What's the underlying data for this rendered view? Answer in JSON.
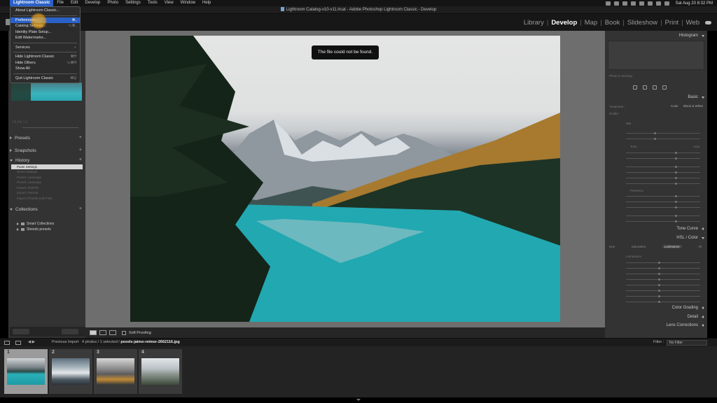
{
  "menubar": {
    "apple_icon": "apple-icon",
    "items": [
      "Lightroom Classic",
      "File",
      "Edit",
      "Develop",
      "Photo",
      "Settings",
      "Tools",
      "View",
      "Window",
      "Help"
    ],
    "clock": "Sat Aug 20  8:32 PM"
  },
  "window": {
    "title": "Lightroom Catalog-v10-v11.lrcat - Adobe Photoshop Lightroom Classic - Develop"
  },
  "modules": [
    "Library",
    "Develop",
    "Map",
    "Book",
    "Slideshow",
    "Print",
    "Web"
  ],
  "active_module": "Develop",
  "app_menu": {
    "items": [
      {
        "label": "About Lightroom Classic...",
        "shortcut": ""
      },
      {
        "label": "Preferences...",
        "shortcut": "⌘,"
      },
      {
        "label": "Catalog Settings...",
        "shortcut": "⌥⌘,"
      },
      {
        "label": "Identity Plate Setup...",
        "shortcut": ""
      },
      {
        "label": "Edit Watermarks...",
        "shortcut": ""
      },
      {
        "label": "Services",
        "shortcut": ""
      },
      {
        "label": "Hide Lightroom Classic",
        "shortcut": "⌘H"
      },
      {
        "label": "Hide Others",
        "shortcut": "⌥⌘H"
      },
      {
        "label": "Show All",
        "shortcut": ""
      },
      {
        "label": "Quit Lightroom Classic",
        "shortcut": "⌘Q"
      }
    ]
  },
  "left_panel": {
    "navigator_faint": "Fit  Fill  1:1",
    "sections": [
      "Presets",
      "Snapshots",
      "History",
      "Collections"
    ],
    "history_items": [
      {
        "label": "Paste Settings",
        "value": ""
      },
      {
        "label": "Reset Settings",
        "value": ""
      },
      {
        "label": "Preset: Lanscape",
        "value": ""
      },
      {
        "label": "Preset: Lanscape",
        "value": ""
      },
      {
        "label": "Preset: PORTR",
        "value": ""
      },
      {
        "label": "Export: Portrait",
        "value": ""
      },
      {
        "label": "Import (7/22/22 6:00 PM)",
        "value": ""
      }
    ],
    "collections": [
      "Smart Collections",
      "Sheeds presets"
    ]
  },
  "center": {
    "toast": "The file could not be found.",
    "toolbar_label": "Soft Proofing"
  },
  "right_panel": {
    "histogram_title": "Histogram",
    "histogram_label": "Photo is missing",
    "basic_title": "Basic",
    "treatment_label": "Treatment :",
    "treatment_options": [
      "Color",
      "Black & White"
    ],
    "profile_label": "Profile :",
    "wb_label": "WB :",
    "tone_label": "Tone",
    "auto_label": "Auto",
    "presence_label": "Presence",
    "tone_curve_title": "Tone Curve",
    "hsl_title": "HSL / Color",
    "hsl_tabs": [
      "Hue",
      "Saturation",
      "Luminance",
      "All"
    ],
    "hsl_active": "Luminance",
    "luminance_label": "Luminance",
    "color_grading_title": "Color Grading",
    "detail_title": "Detail",
    "lens_title": "Lens Corrections"
  },
  "filmstrip_bar": {
    "source": "Previous Import",
    "count": "4 photos / 1 selected /",
    "filename": "pexels-jaime-reimer-2662116.jpg",
    "filter_label": "Filter :",
    "filter_value": "No Filter"
  },
  "filmstrip": [
    {
      "num": "1",
      "selected": true
    },
    {
      "num": "2",
      "selected": false
    },
    {
      "num": "3",
      "selected": false
    },
    {
      "num": "4",
      "selected": false
    }
  ],
  "colors": {
    "menu_highlight": "#2a61c8",
    "panel_bg": "#333333",
    "dark_bg": "#171717",
    "lake": "#27b3bc"
  }
}
